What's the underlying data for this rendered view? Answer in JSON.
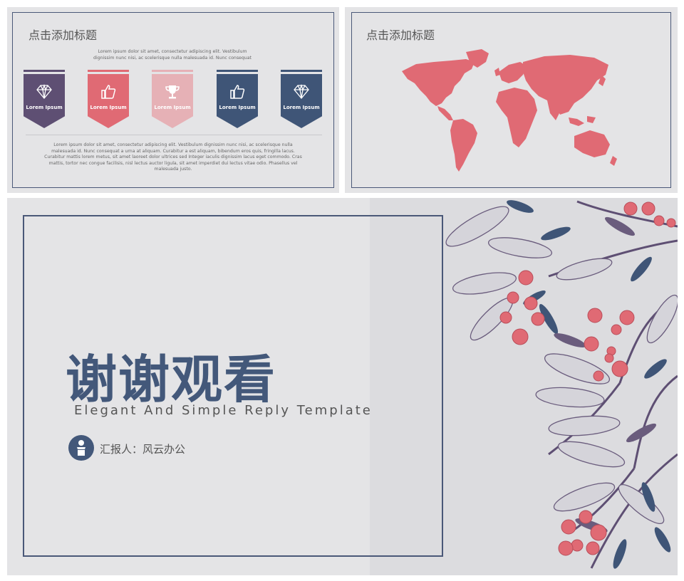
{
  "slides": {
    "slide1": {
      "title": "点击添加标题",
      "intro": "Lorem ipsum dolor sit amet, consectetur adipiscing elit. Vestibulum dignissim nunc nisi, ac scelerisque nulla malesuada id. Nunc consequat",
      "badges": [
        {
          "label": "Lorem Ipsum",
          "icon": "diamond-icon",
          "color": "#5e4f73"
        },
        {
          "label": "Lorem Ipsum",
          "icon": "thumbs-up-icon",
          "color": "#e06a74"
        },
        {
          "label": "Lorem Ipsum",
          "icon": "trophy-icon",
          "color": "#e6b1b6"
        },
        {
          "label": "Lorem Ipsum",
          "icon": "thumbs-up-icon",
          "color": "#3f5577"
        },
        {
          "label": "Lorem Ipsum",
          "icon": "diamond-icon",
          "color": "#3f5577"
        }
      ],
      "body": "Lorem ipsum dolor sit amet, consectetur adipiscing elit. Vestibulum dignissim nunc nisi, ac scelerisque nulla malesuada id. Nunc consequat a urna at aliquam. Curabitur a est aliquam, bibendum eros quis, fringilla lacus. Curabitur mattis lorem metus, sit amet laoreet dolor ultrices sed Integer iaculis dignissim lacus eget commodo. Cras mattis, tortor nec congue facilisis, nisl lectus auctor ligula, sit amet imperdiet dui lectus vitae odio. Phasellus vel malesuada justo."
    },
    "slide2": {
      "title": "点击添加标题",
      "map_icon": "world-map-icon",
      "map_color": "#e06a74"
    },
    "slide3": {
      "title": "谢谢观看",
      "subtitle": "Elegant And Simple Reply Template",
      "reporter": "汇报人：风云办公",
      "avatar_icon": "presenter-icon",
      "accent": "#43587a"
    }
  }
}
